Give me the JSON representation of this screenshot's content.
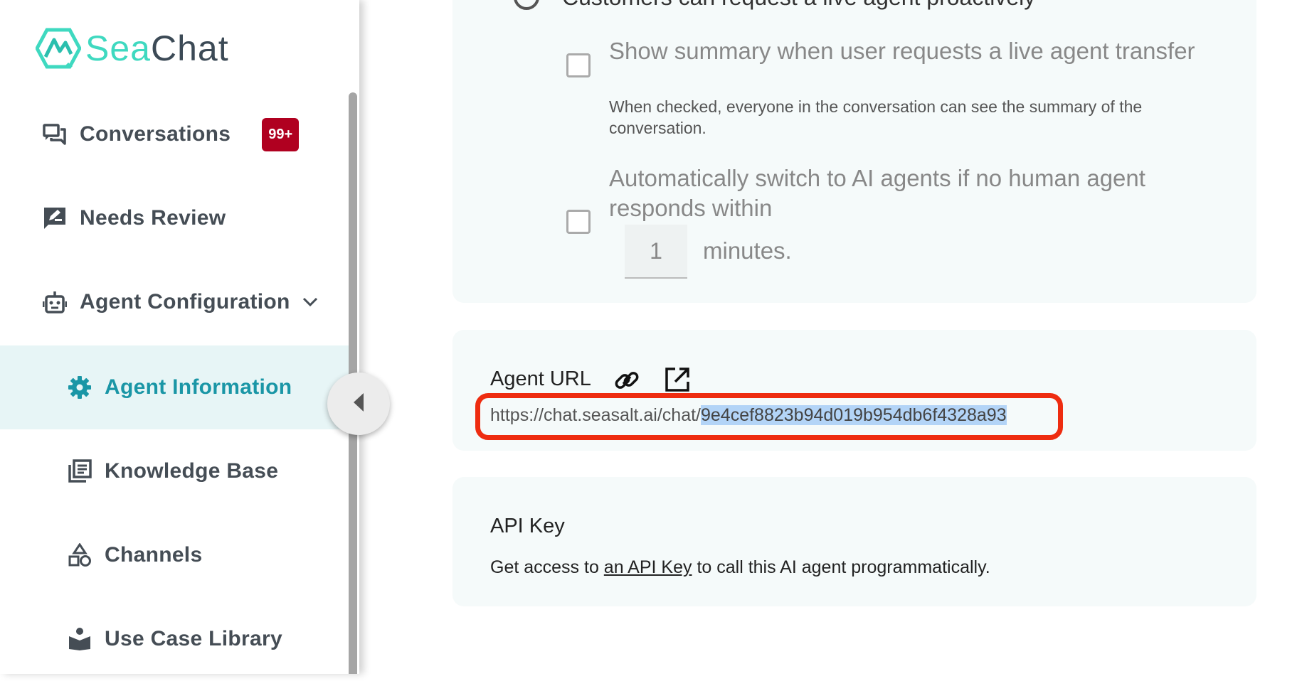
{
  "app": {
    "logo_part1": "Sea",
    "logo_part2": "Chat",
    "colors": {
      "accent": "#1a96a6",
      "logo_teal": "#3fd9c0",
      "badge": "#b00020",
      "highlight_ring": "#ee2c10"
    }
  },
  "sidebar": {
    "items": [
      {
        "label": "Conversations",
        "icon": "chat-bubbles-icon",
        "badge": "99+"
      },
      {
        "label": "Needs Review",
        "icon": "rate-review-icon"
      },
      {
        "label": "Agent Configuration",
        "icon": "robot-icon",
        "expandable": true
      },
      {
        "label": "Agent Information",
        "icon": "gear-icon",
        "active": true
      },
      {
        "label": "Knowledge Base",
        "icon": "library-books-icon"
      },
      {
        "label": "Channels",
        "icon": "shapes-icon"
      },
      {
        "label": "Use Case Library",
        "icon": "book-reader-icon"
      }
    ]
  },
  "live_agent": {
    "radio_label": "Customers can request a live agent proactively",
    "show_summary": {
      "title": "Show summary when user requests a live agent transfer",
      "help": "When checked, everyone in the conversation can see the summary of the conversation."
    },
    "auto_switch": {
      "title": "Automatically switch to AI agents if no human agent responds within",
      "minutes_value": "1",
      "minutes_label": "minutes."
    }
  },
  "agent_url": {
    "title": "Agent URL",
    "url_prefix": "https://chat.seasalt.ai/chat/",
    "url_id": "9e4cef8823b94d019b954db6f4328a93"
  },
  "api_key": {
    "title": "API Key",
    "desc_before": "Get access to ",
    "link_text": "an API Key",
    "desc_after": " to call this AI agent programmatically."
  }
}
